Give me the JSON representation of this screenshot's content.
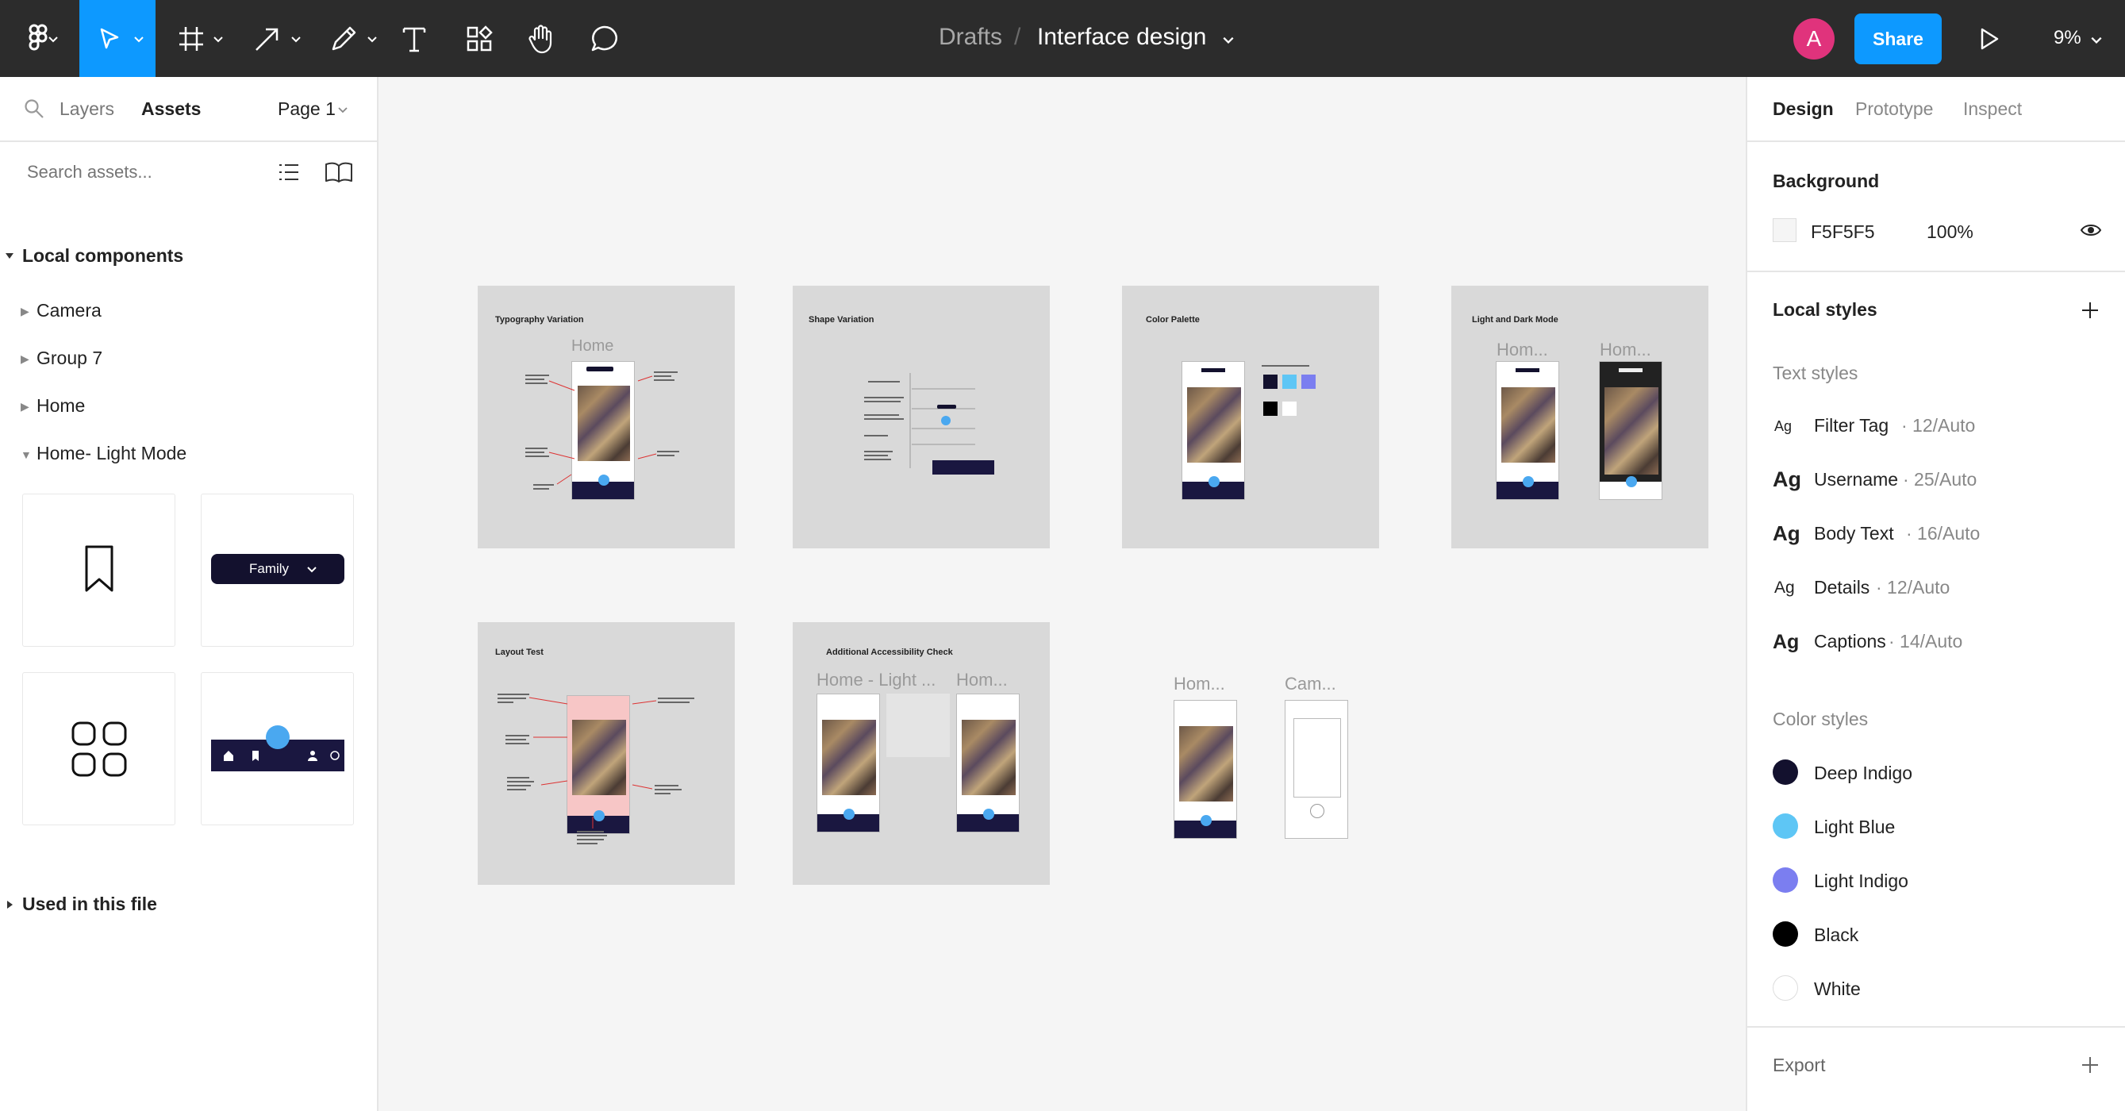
{
  "toolbar": {
    "breadcrumb_parent": "Drafts",
    "breadcrumb_sep": "/",
    "file_name": "Interface design",
    "avatar_initial": "A",
    "share_label": "Share",
    "zoom": "9%"
  },
  "left_panel": {
    "tabs": {
      "layers": "Layers",
      "assets": "Assets"
    },
    "page_selector": "Page 1",
    "search_placeholder": "Search assets...",
    "local_components_title": "Local components",
    "components": [
      {
        "label": "Camera"
      },
      {
        "label": "Group 7"
      },
      {
        "label": "Home"
      },
      {
        "label": "Home- Light Mode"
      }
    ],
    "family_chip": "Family",
    "used_in_file_title": "Used in this file"
  },
  "canvas": {
    "frames": [
      {
        "title": "Typography Variation",
        "ghost": "Home"
      },
      {
        "title": "Shape Variation"
      },
      {
        "title": "Color Palette"
      },
      {
        "title": "Light and Dark Mode",
        "ghost_a": "Hom...",
        "ghost_b": "Hom..."
      },
      {
        "title": "Layout Test"
      },
      {
        "title": "Additional Accessibility Check",
        "ghost_a": "Home - Light ...",
        "ghost_b": "Hom..."
      }
    ],
    "loose_labels": {
      "home": "Hom...",
      "camera": "Cam..."
    }
  },
  "right_panel": {
    "tabs": {
      "design": "Design",
      "prototype": "Prototype",
      "inspect": "Inspect"
    },
    "background_title": "Background",
    "background_hex": "F5F5F5",
    "background_opacity": "100%",
    "local_styles_title": "Local styles",
    "text_styles_title": "Text styles",
    "text_styles": [
      {
        "ag": "Ag",
        "name": "Filter Tag",
        "spec": " · 12/Auto"
      },
      {
        "ag": "Ag",
        "name": "Username",
        "spec": " · 25/Auto"
      },
      {
        "ag": "Ag",
        "name": "Body Text",
        "spec": " · 16/Auto"
      },
      {
        "ag": "Ag",
        "name": "Details",
        "spec": " · 12/Auto"
      },
      {
        "ag": "Ag",
        "name": "Captions",
        "spec": " · 14/Auto"
      }
    ],
    "color_styles_title": "Color styles",
    "color_styles": [
      {
        "name": "Deep Indigo",
        "color": "#13112e"
      },
      {
        "name": "Light Blue",
        "color": "#5ec6f5"
      },
      {
        "name": "Light Indigo",
        "color": "#7b7ef0"
      },
      {
        "name": "Black",
        "color": "#000000"
      },
      {
        "name": "White",
        "color": "#ffffff"
      }
    ],
    "export_title": "Export"
  },
  "colors": {
    "toolbar_bg": "#2c2c2c",
    "accent": "#0d99ff",
    "avatar": "#e0337c",
    "canvas_bg": "#f5f5f5",
    "frame_bg": "#d9d9d9"
  }
}
